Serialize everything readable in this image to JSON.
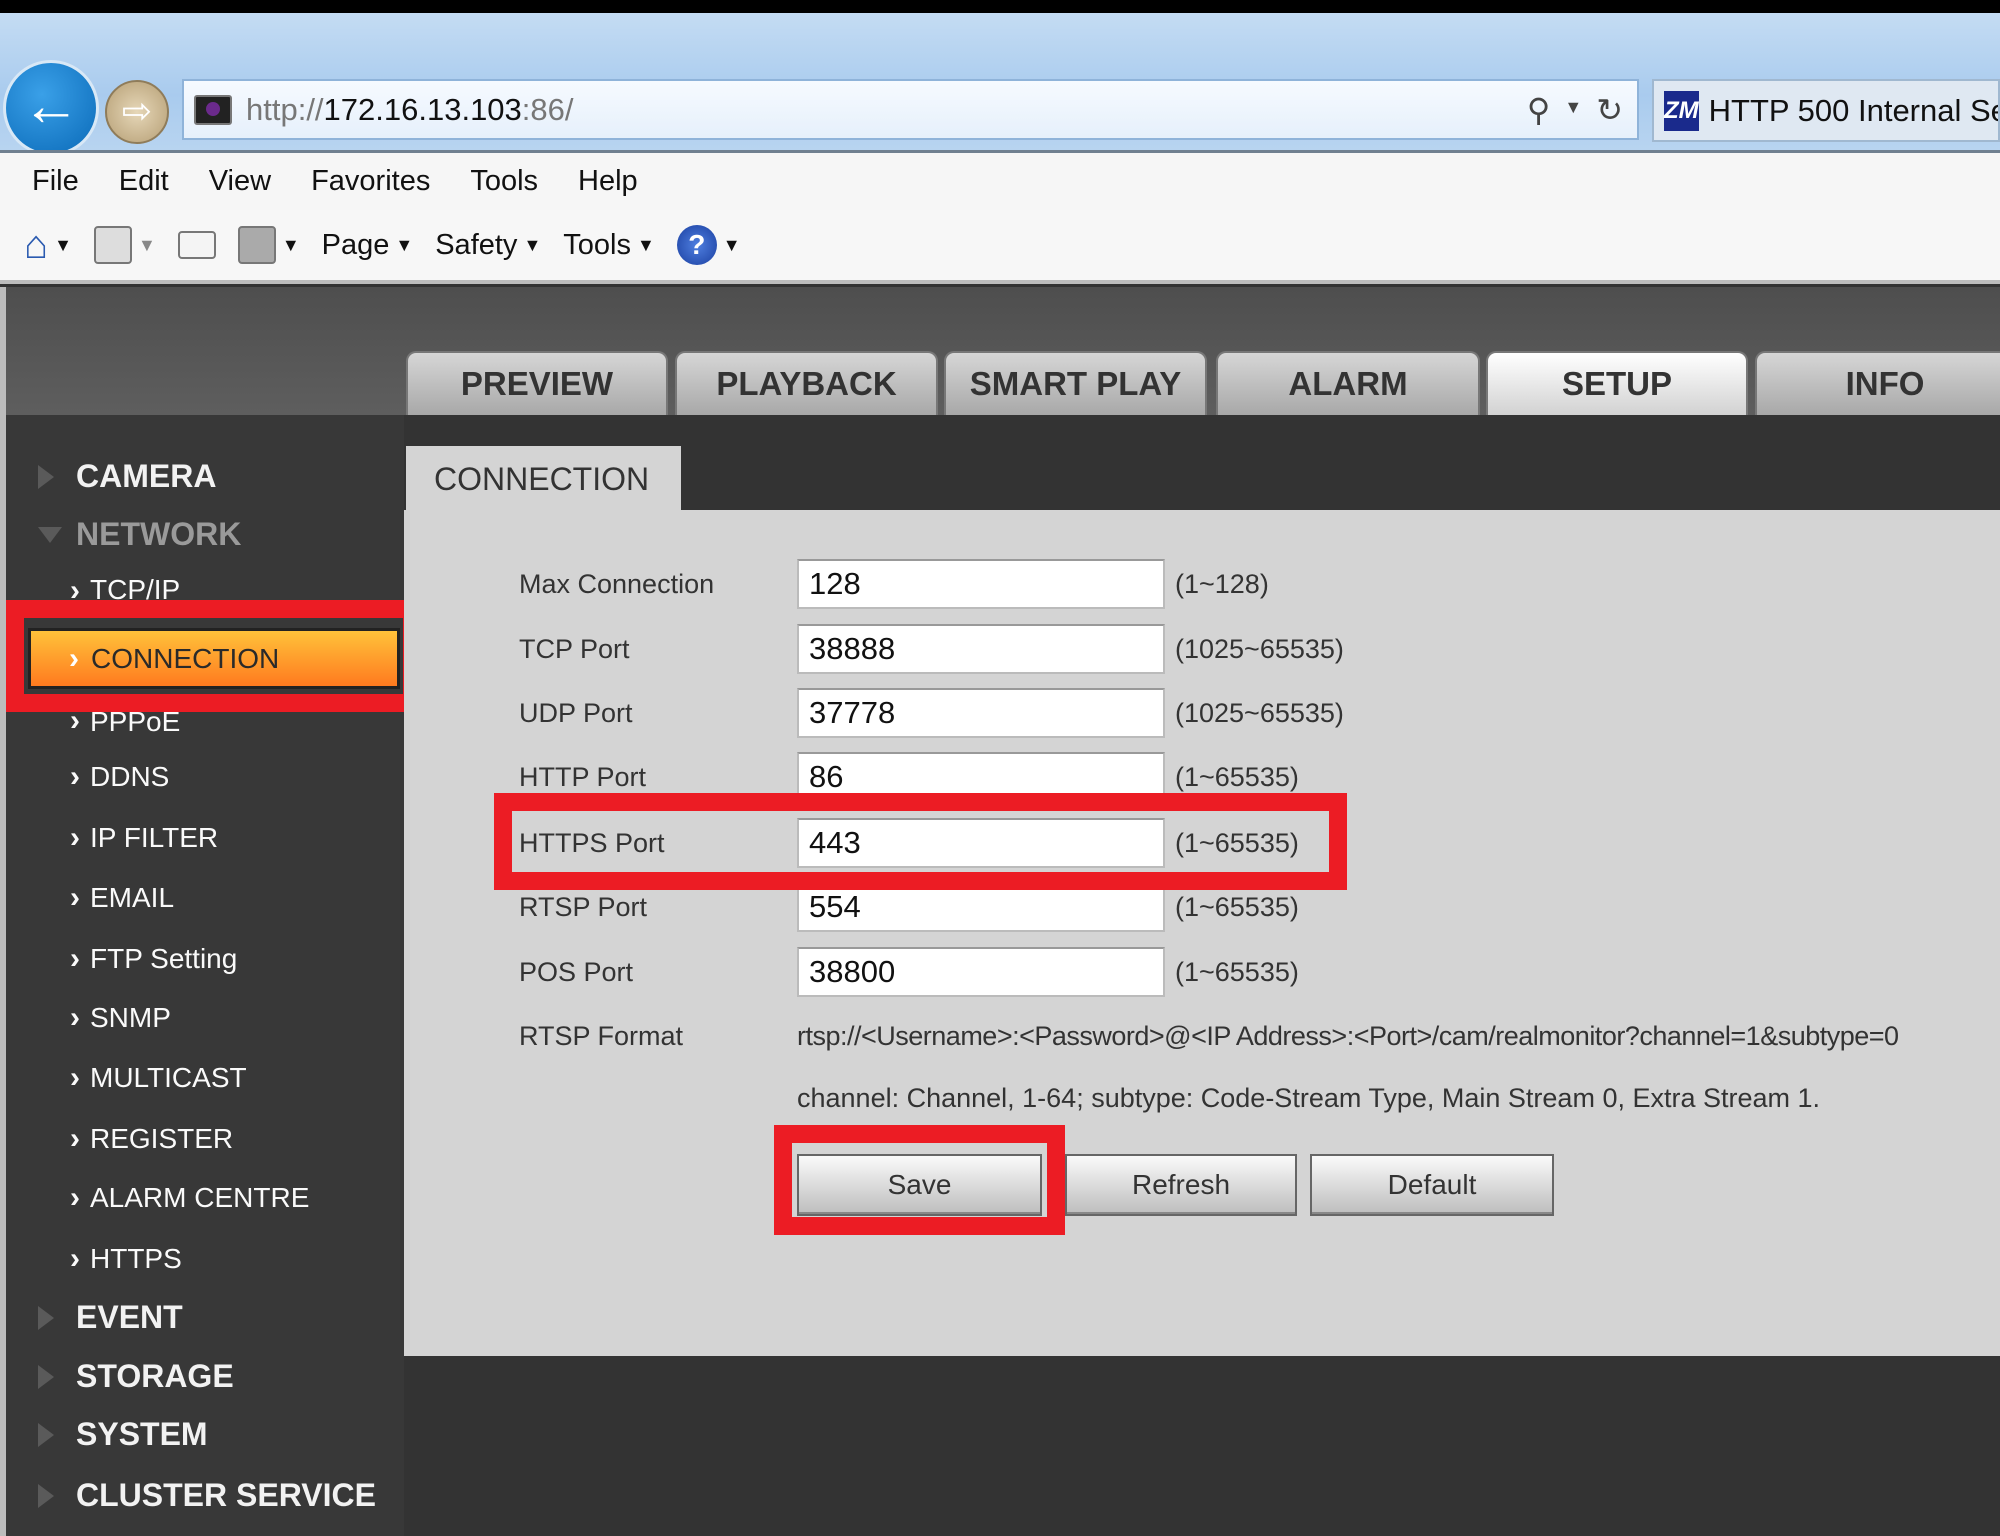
{
  "browser": {
    "url_prefix": "http://",
    "url_host": "172.16.13.103",
    "url_suffix": ":86/",
    "tab_title": "HTTP 500 Internal Ser",
    "tab_icon_text": "ZM",
    "menu": [
      "File",
      "Edit",
      "View",
      "Favorites",
      "Tools",
      "Help"
    ],
    "command_bar": {
      "page": "Page",
      "safety": "Safety",
      "tools": "Tools",
      "help": "?"
    }
  },
  "main_tabs": [
    {
      "label": "PREVIEW"
    },
    {
      "label": "PLAYBACK"
    },
    {
      "label": "SMART PLAY"
    },
    {
      "label": "ALARM"
    },
    {
      "label": "SETUP",
      "active": true
    },
    {
      "label": "INFO"
    }
  ],
  "sidebar": {
    "camera": "CAMERA",
    "network": "NETWORK",
    "network_items": [
      "TCP/IP",
      "CONNECTION",
      "PPPoE",
      "DDNS",
      "IP FILTER",
      "EMAIL",
      "FTP Setting",
      "SNMP",
      "MULTICAST",
      "REGISTER",
      "ALARM CENTRE",
      "HTTPS"
    ],
    "active_item": "CONNECTION",
    "event": "EVENT",
    "storage": "STORAGE",
    "system": "SYSTEM",
    "cluster": "CLUSTER SERVICE"
  },
  "content": {
    "tab_title": "CONNECTION",
    "fields": [
      {
        "label": "Max Connection",
        "value": "128",
        "range": "(1~128)"
      },
      {
        "label": "TCP Port",
        "value": "38888",
        "range": "(1025~65535)"
      },
      {
        "label": "UDP Port",
        "value": "37778",
        "range": "(1025~65535)"
      },
      {
        "label": "HTTP Port",
        "value": "86",
        "range": "(1~65535)"
      },
      {
        "label": "HTTPS Port",
        "value": "443",
        "range": "(1~65535)"
      },
      {
        "label": "RTSP Port",
        "value": "554",
        "range": "(1~65535)"
      },
      {
        "label": "POS Port",
        "value": "38800",
        "range": "(1~65535)"
      }
    ],
    "rtsp_format_label": "RTSP Format",
    "rtsp_format": "rtsp://<Username>:<Password>@<IP Address>:<Port>/cam/realmonitor?channel=1&subtype=0",
    "rtsp_note": "channel: Channel, 1-64; subtype: Code-Stream Type, Main Stream 0, Extra Stream 1.",
    "buttons": {
      "save": "Save",
      "refresh": "Refresh",
      "default": "Default"
    }
  },
  "colors": {
    "highlight_box": "#ec1c24",
    "active_item": "#ff9a2a",
    "panel": "#d4d4d4",
    "sidebar": "#383838"
  }
}
